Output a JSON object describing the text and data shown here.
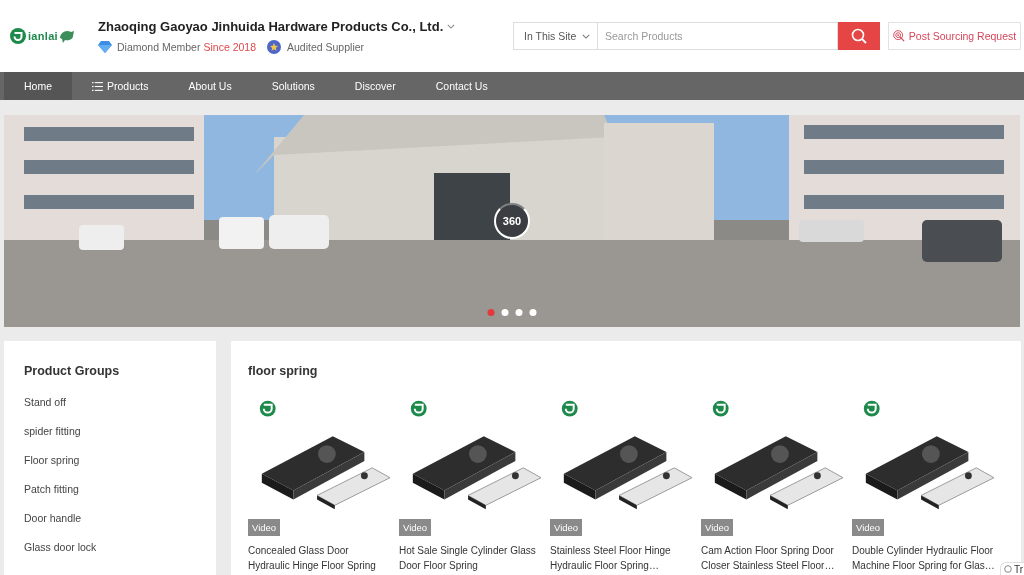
{
  "header": {
    "logo": {
      "wordmark": "ianlai"
    },
    "company_name": "Zhaoqing Gaoyao Jinhuida Hardware Products Co., Ltd.",
    "membership": {
      "label": "Diamond Member",
      "since": "Since 2018"
    },
    "audit": {
      "label": "Audited Supplier"
    }
  },
  "search": {
    "scope": "In This Site",
    "placeholder": "Search Products"
  },
  "sourcing_button": {
    "label": "Post Sourcing Request"
  },
  "nav": {
    "items": [
      {
        "label": "Home",
        "kind": "link",
        "selected": true
      },
      {
        "label": "Products",
        "kind": "menu",
        "selected": false
      },
      {
        "label": "About Us",
        "kind": "link",
        "selected": false
      },
      {
        "label": "Solutions",
        "kind": "link",
        "selected": false
      },
      {
        "label": "Discover",
        "kind": "link",
        "selected": false
      },
      {
        "label": "Contact Us",
        "kind": "link",
        "selected": false
      }
    ]
  },
  "banner": {
    "badge": "360",
    "slides": [
      {
        "selected": true
      },
      {
        "selected": false
      },
      {
        "selected": false
      },
      {
        "selected": false
      }
    ]
  },
  "sidebar": {
    "title": "Product Groups",
    "items": [
      "Stand off",
      "spider fitting",
      "Floor spring",
      "Patch fitting",
      "Door handle",
      "Glass door lock"
    ]
  },
  "main": {
    "title": "floor spring",
    "products": [
      {
        "badge": "Video",
        "title": "Concealed Glass Door Hydraulic Hinge Floor Spring"
      },
      {
        "badge": "Video",
        "title": "Hot Sale Single Cylinder Glass Door Floor Spring"
      },
      {
        "badge": "Video",
        "title": "Stainless Steel Floor Hinge Hydraulic Floor Spring…"
      },
      {
        "badge": "Video",
        "title": "Cam Action Floor Spring Door Closer Stainless Steel Floor…"
      },
      {
        "badge": "Video",
        "title": "Double Cylinder Hydraulic Floor Machine Floor Spring for Glas…"
      }
    ]
  },
  "corner_widget": {
    "label": "Tr"
  }
}
